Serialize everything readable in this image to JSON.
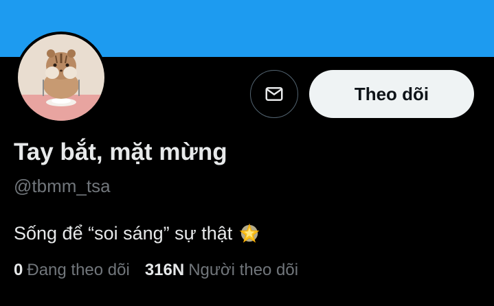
{
  "profile": {
    "display_name": "Tay bắt, mặt mừng",
    "handle": "@tbmm_tsa",
    "bio_text": "Sống để “soi sáng” sự thật",
    "bio_emoji_icon": "glowing-star-icon"
  },
  "actions": {
    "message_icon": "envelope-icon",
    "follow_label": "Theo dõi"
  },
  "stats": {
    "following_count": "0",
    "following_label": "Đang theo dõi",
    "followers_count": "316N",
    "followers_label": "Người theo dõi"
  },
  "colors": {
    "banner": "#1d9bf0",
    "background": "#000000",
    "primary_text": "#e7e9ea",
    "secondary_text": "#71767b",
    "follow_button_bg": "#eff3f4",
    "follow_button_text": "#0f1419"
  }
}
